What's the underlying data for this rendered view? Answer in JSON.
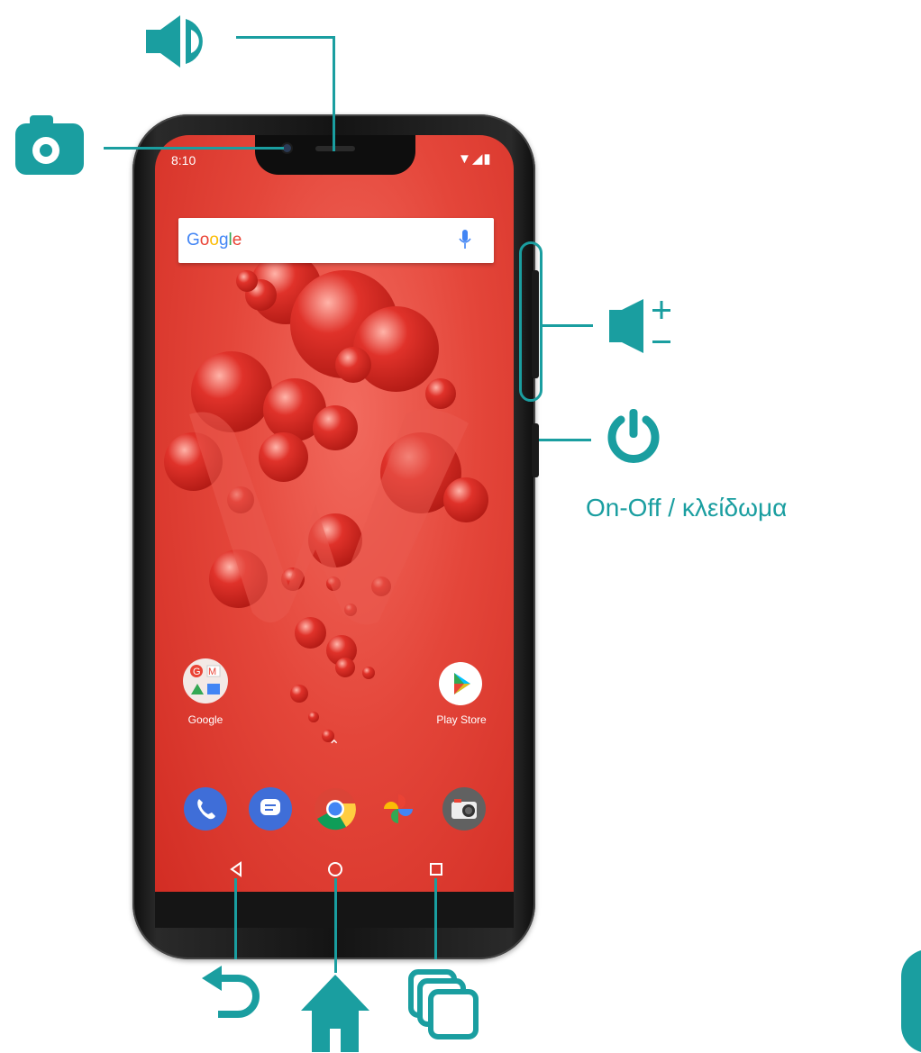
{
  "status_bar": {
    "time": "8:10",
    "icons": "▼◢▮"
  },
  "search": {
    "logo_text": "Google"
  },
  "home_screen": {
    "apps": [
      {
        "label": "Google"
      },
      {
        "label": "Play Store"
      }
    ],
    "dock": [
      "phone",
      "messages",
      "chrome",
      "photos",
      "camera"
    ]
  },
  "annotations": {
    "power_label": "On-Off / κλείδωμα"
  },
  "colors": {
    "accent": "#1a9ea0",
    "wallpaper": "#e4463a"
  },
  "icons": {
    "speaker": "speaker-icon",
    "camera": "camera-icon",
    "volume": "volume-icon",
    "power": "power-icon",
    "back": "back-icon",
    "home": "home-icon",
    "recents": "recents-icon"
  }
}
